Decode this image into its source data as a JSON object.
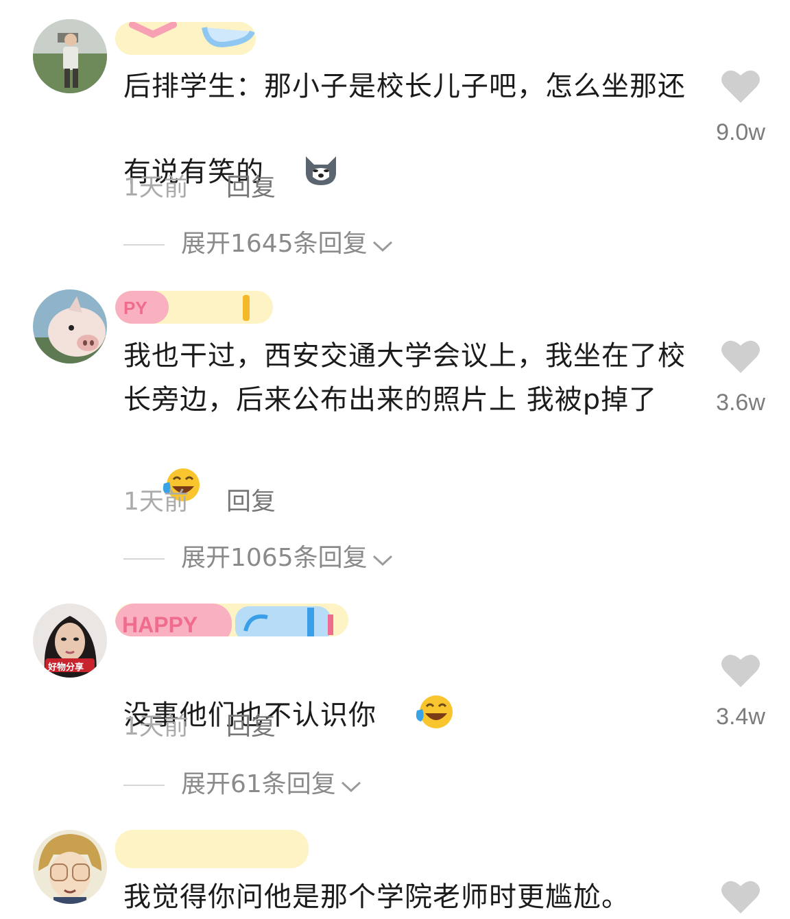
{
  "comments": [
    {
      "text": "后排学生：那小子是校长儿子吧，怎么坐那还有说有笑的",
      "time": "1天前",
      "reply_label": "回复",
      "expand_label": "展开1645条回复",
      "likes": "9.0w",
      "avatar_icon": "boy-photo-avatar",
      "emoji": "husky-doge-emoji"
    },
    {
      "text": "我也干过，西安交通大学会议上，我坐在了校长旁边，后来公布出来的照片上 我被p掉了",
      "time": "1天前",
      "reply_label": "回复",
      "expand_label": "展开1065条回复",
      "likes": "3.6w",
      "avatar_icon": "piglet-avatar",
      "emoji": "laughing-tears-emoji"
    },
    {
      "text": "没事他们也不认识你",
      "time": "1天前",
      "reply_label": "回复",
      "expand_label": "展开61条回复",
      "likes": "3.4w",
      "avatar_icon": "woman-portrait-avatar",
      "avatar_badge": "好物分享",
      "emoji": "laughing-tears-emoji"
    },
    {
      "text": "我觉得你问他是那个学院老师时更尴尬。",
      "avatar_icon": "anime-covering-eyes-avatar"
    }
  ],
  "colors": {
    "text": "#1b1b1b",
    "meta": "#9a9a9a",
    "heart": "#cfcfcf",
    "redact_yellow": "#fdf3c4",
    "redact_pink": "#f9a5b8",
    "redact_blue": "#b7dcf7"
  }
}
